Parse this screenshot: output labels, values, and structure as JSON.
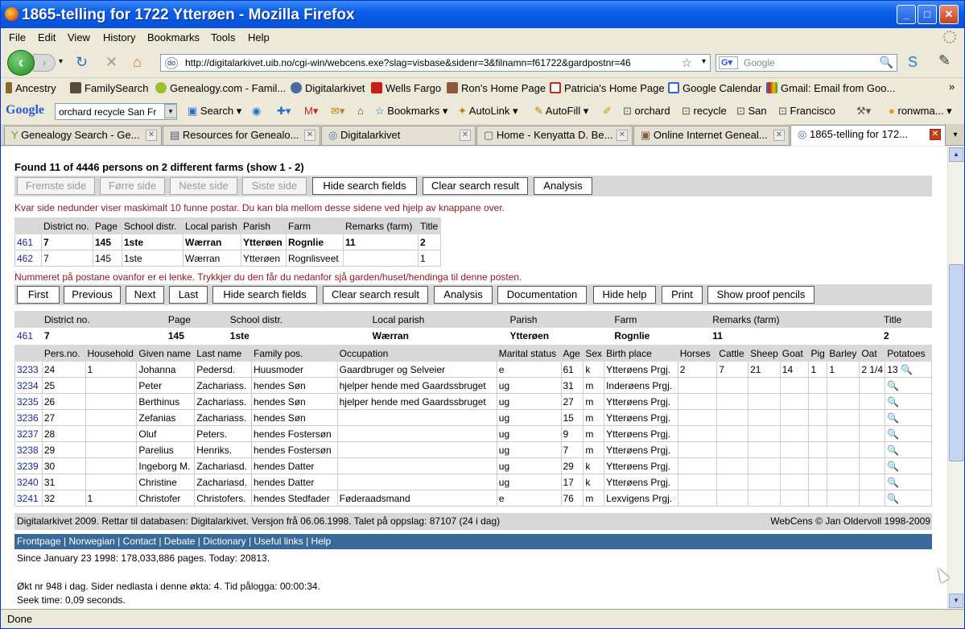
{
  "window": {
    "title": "1865-telling for 1722 Ytterøen - Mozilla Firefox"
  },
  "menu": [
    "File",
    "Edit",
    "View",
    "History",
    "Bookmarks",
    "Tools",
    "Help"
  ],
  "nav": {
    "url": "http://digitalarkivet.uib.no/cgi-win/webcens.exe?slag=visbase&sidenr=3&filnamn=f61722&gardpostnr=46",
    "search_placeholder": "Google",
    "site_icon_text": "do"
  },
  "bookmarks": [
    "Ancestry",
    "FamilySearch",
    "Genealogy.com - Famil...",
    "Digitalarkivet",
    "Wells Fargo",
    "Ron's Home Page",
    "Patricia's Home Page",
    "Google Calendar",
    "Gmail: Email from Goo..."
  ],
  "gtoolbar": {
    "logo": "Google",
    "query": "orchard recycle San Fr",
    "search": "Search",
    "bookmarks": "Bookmarks",
    "autolink": "AutoLink",
    "autofill": "AutoFill",
    "terms": [
      "orchard",
      "recycle",
      "San",
      "Francisco"
    ],
    "user": "ronwma..."
  },
  "tabs": [
    "Genealogy Search - Ge...",
    "Resources for Genealo...",
    "Digitalarkivet",
    "Home - Kenyatta D. Be...",
    "Online Internet Geneal...",
    "1865-telling for 172..."
  ],
  "found_text": "Found 11 of 4446 persons on 2 different farms (show 1 - 2)",
  "bar1": [
    "Fremste side",
    "Førre side",
    "Neste side",
    "Siste side",
    "Hide search fields",
    "Clear search result",
    "Analysis"
  ],
  "msg1": "Kvar side nedunder viser maskimalt 10 funne postar. Du kan bla mellom desse sidene ved hjelp av knappane over.",
  "farm_headers": [
    "",
    "District no.",
    "Page",
    "School distr.",
    "Local parish",
    "Parish",
    "Farm",
    "Remarks (farm)",
    "Title"
  ],
  "farms": [
    [
      "461",
      "7",
      "145",
      "1ste",
      "Wærran",
      "Ytterøen",
      "Rognlie",
      "11",
      "2"
    ],
    [
      "462",
      "7",
      "145",
      "1ste",
      "Wærran",
      "Ytterøen",
      "Rognlisveet",
      "",
      "1"
    ]
  ],
  "msg2": "Nummeret på postane ovanfor er ei lenke. Trykkjer du den får du nedanfor sjå garden/huset/hendinga til denne posten.",
  "bar2": [
    "First",
    "Previous",
    "Next",
    "Last",
    "Hide search fields",
    "Clear search result",
    "Analysis",
    "Documentation",
    "Hide help",
    "Print",
    "Show proof pencils"
  ],
  "farm2_headers": [
    "",
    "District no.",
    "Page",
    "School distr.",
    "Local parish",
    "Parish",
    "Farm",
    "Remarks (farm)",
    "Title"
  ],
  "farm2": [
    "461",
    "7",
    "145",
    "1ste",
    "Wærran",
    "Ytterøen",
    "Rognlie",
    "11",
    "2"
  ],
  "person_headers": [
    "",
    "Pers.no.",
    "Household",
    "Given name",
    "Last name",
    "Family pos.",
    "Occupation",
    "Marital status",
    "Age",
    "Sex",
    "Birth place",
    "Horses",
    "Cattle",
    "Sheep",
    "Goat",
    "Pig",
    "Barley",
    "Oat",
    "Potatoes"
  ],
  "persons": [
    [
      "3233",
      "24",
      "1",
      "Johanna",
      "Pedersd.",
      "Huusmoder",
      "Gaardbruger og Selveier",
      "e",
      "61",
      "k",
      "Ytterøens Prgj.",
      "2",
      "7",
      "21",
      "14",
      "1",
      "1",
      "2 1/4",
      "13"
    ],
    [
      "3234",
      "25",
      "",
      "Peter",
      "Zachariass.",
      "hendes Søn",
      "hjelper hende med Gaardssbruget",
      "ug",
      "31",
      "m",
      "Inderøens Prgj.",
      "",
      "",
      "",
      "",
      "",
      "",
      "",
      ""
    ],
    [
      "3235",
      "26",
      "",
      "Berthinus",
      "Zachariass.",
      "hendes Søn",
      "hjelper hende med Gaardssbruget",
      "ug",
      "27",
      "m",
      "Ytterøens Prgj.",
      "",
      "",
      "",
      "",
      "",
      "",
      "",
      ""
    ],
    [
      "3236",
      "27",
      "",
      "Zefanias",
      "Zachariass.",
      "hendes Søn",
      "",
      "ug",
      "15",
      "m",
      "Ytterøens Prgj.",
      "",
      "",
      "",
      "",
      "",
      "",
      "",
      ""
    ],
    [
      "3237",
      "28",
      "",
      "Oluf",
      "Peters.",
      "hendes Fostersøn",
      "",
      "ug",
      "9",
      "m",
      "Ytterøens Prgj.",
      "",
      "",
      "",
      "",
      "",
      "",
      "",
      ""
    ],
    [
      "3238",
      "29",
      "",
      "Parelius",
      "Henriks.",
      "hendes Fostersøn",
      "",
      "ug",
      "7",
      "m",
      "Ytterøens Prgj.",
      "",
      "",
      "",
      "",
      "",
      "",
      "",
      ""
    ],
    [
      "3239",
      "30",
      "",
      "Ingeborg M.",
      "Zachariasd.",
      "hendes Datter",
      "",
      "ug",
      "29",
      "k",
      "Ytterøens Prgj.",
      "",
      "",
      "",
      "",
      "",
      "",
      "",
      ""
    ],
    [
      "3240",
      "31",
      "",
      "Christine",
      "Zachariasd.",
      "hendes Datter",
      "",
      "ug",
      "17",
      "k",
      "Ytterøens Prgj.",
      "",
      "",
      "",
      "",
      "",
      "",
      "",
      ""
    ],
    [
      "3241",
      "32",
      "1",
      "Christofer",
      "Christofers.",
      "hendes Stedfader",
      "Føderaadsmand",
      "e",
      "76",
      "m",
      "Lexvigens Prgj.",
      "",
      "",
      "",
      "",
      "",
      "",
      "",
      ""
    ]
  ],
  "footer_left": "Digitalarkivet 2009. Rettar til databasen: Digitalarkivet. Versjon frå 06.06.1998. Talet på oppslag: 87107 (24 i dag)",
  "footer_right": "WebCens © Jan Oldervoll 1998-2009",
  "footer_links": "Frontpage | Norwegian | Contact | Debate | Dictionary | Useful links | Help",
  "since": "Since January 23 1998: 178,033,886 pages. Today: 20813.",
  "session": "Økt nr 948 i dag. Sider nedlasta i denne økta: 4. Tid pålogga: 00:00:34.",
  "seek": "Seek time: 0,09 seconds.",
  "status": "Done",
  "icons": {
    "magnifier": "magnifier-icon"
  }
}
